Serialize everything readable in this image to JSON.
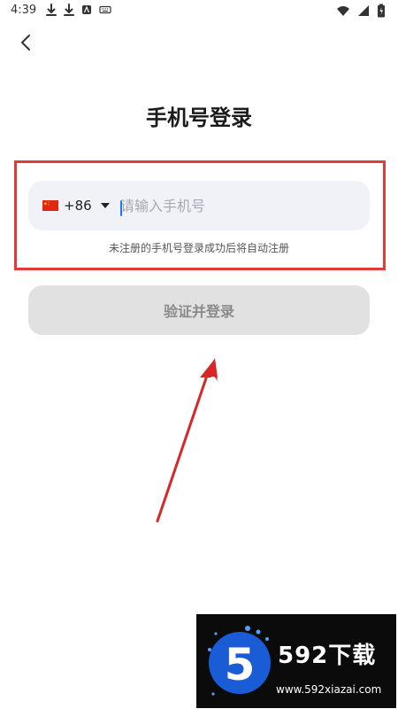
{
  "status_bar": {
    "time": "4:39",
    "left_icons": [
      "download-icon",
      "download-icon",
      "app-icon",
      "keyboard-icon"
    ],
    "right_icons": [
      "wifi-icon",
      "signal-icon",
      "battery-icon"
    ]
  },
  "header": {
    "back_icon": "back-arrow-icon"
  },
  "page": {
    "title": "手机号登录"
  },
  "phone_input": {
    "country_flag_icon": "china-flag-icon",
    "country_code": "+86",
    "placeholder": "请输入手机号",
    "value": ""
  },
  "hint": {
    "text": "未注册的手机号登录成功后将自动注册"
  },
  "actions": {
    "login_label": "验证并登录"
  },
  "watermark": {
    "logo_digit": "5",
    "brand_text": "592下载",
    "url_text": "www.592xiazai.com"
  },
  "colors": {
    "highlight_border": "#e23a3a",
    "input_bg": "#f0f2f7",
    "button_disabled_bg": "#e1e1e1",
    "button_disabled_text": "#8a8a8a",
    "cursor": "#2f6fff",
    "watermark_bg": "#0b0b0b",
    "watermark_circle": "#1a5bd6"
  }
}
